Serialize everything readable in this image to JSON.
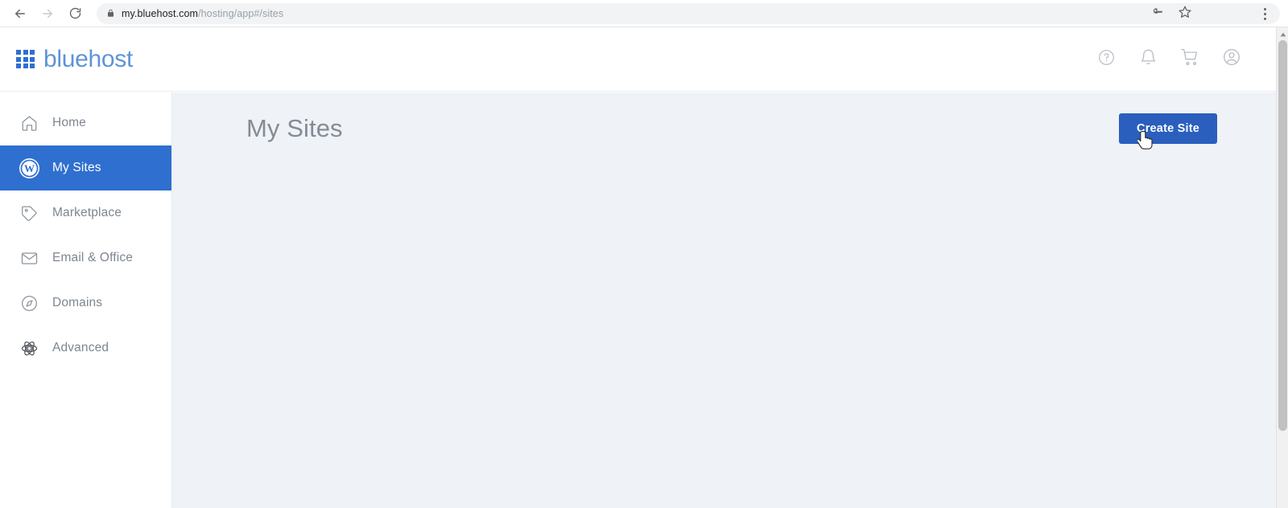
{
  "browser": {
    "back_icon": "arrow-left-icon",
    "forward_icon": "arrow-right-icon",
    "reload_icon": "reload-icon",
    "lock_icon": "lock-icon",
    "url_host": "my.bluehost.com",
    "url_path": "/hosting/app#/sites",
    "url_full": "my.bluehost.com/hosting/app#/sites",
    "password_icon": "key-icon",
    "bookmark_icon": "star-icon",
    "menu_icon": "three-dot-menu-icon"
  },
  "header": {
    "brand": "bluehost",
    "logo_icon": "grid-logo-icon",
    "actions": [
      {
        "name": "help-icon",
        "label": "Help"
      },
      {
        "name": "bell-icon",
        "label": "Notifications"
      },
      {
        "name": "cart-icon",
        "label": "Cart"
      },
      {
        "name": "account-icon",
        "label": "Account"
      }
    ]
  },
  "sidebar": {
    "items": [
      {
        "label": "Home",
        "icon": "home-icon",
        "active": false
      },
      {
        "label": "My Sites",
        "icon": "wordpress-icon",
        "active": true
      },
      {
        "label": "Marketplace",
        "icon": "tag-icon",
        "active": false
      },
      {
        "label": "Email & Office",
        "icon": "envelope-icon",
        "active": false
      },
      {
        "label": "Domains",
        "icon": "compass-icon",
        "active": false
      },
      {
        "label": "Advanced",
        "icon": "atom-icon",
        "active": false
      }
    ]
  },
  "main": {
    "title": "My Sites",
    "create_button": "Create Site",
    "empty": ""
  },
  "colors": {
    "brand_blue": "#2f6fd0",
    "button_blue": "#2a5fbe",
    "logo_text": "#5f93d8",
    "content_bg": "#eff2f6",
    "sidebar_text": "#7d8691",
    "title_gray": "#848c96"
  }
}
